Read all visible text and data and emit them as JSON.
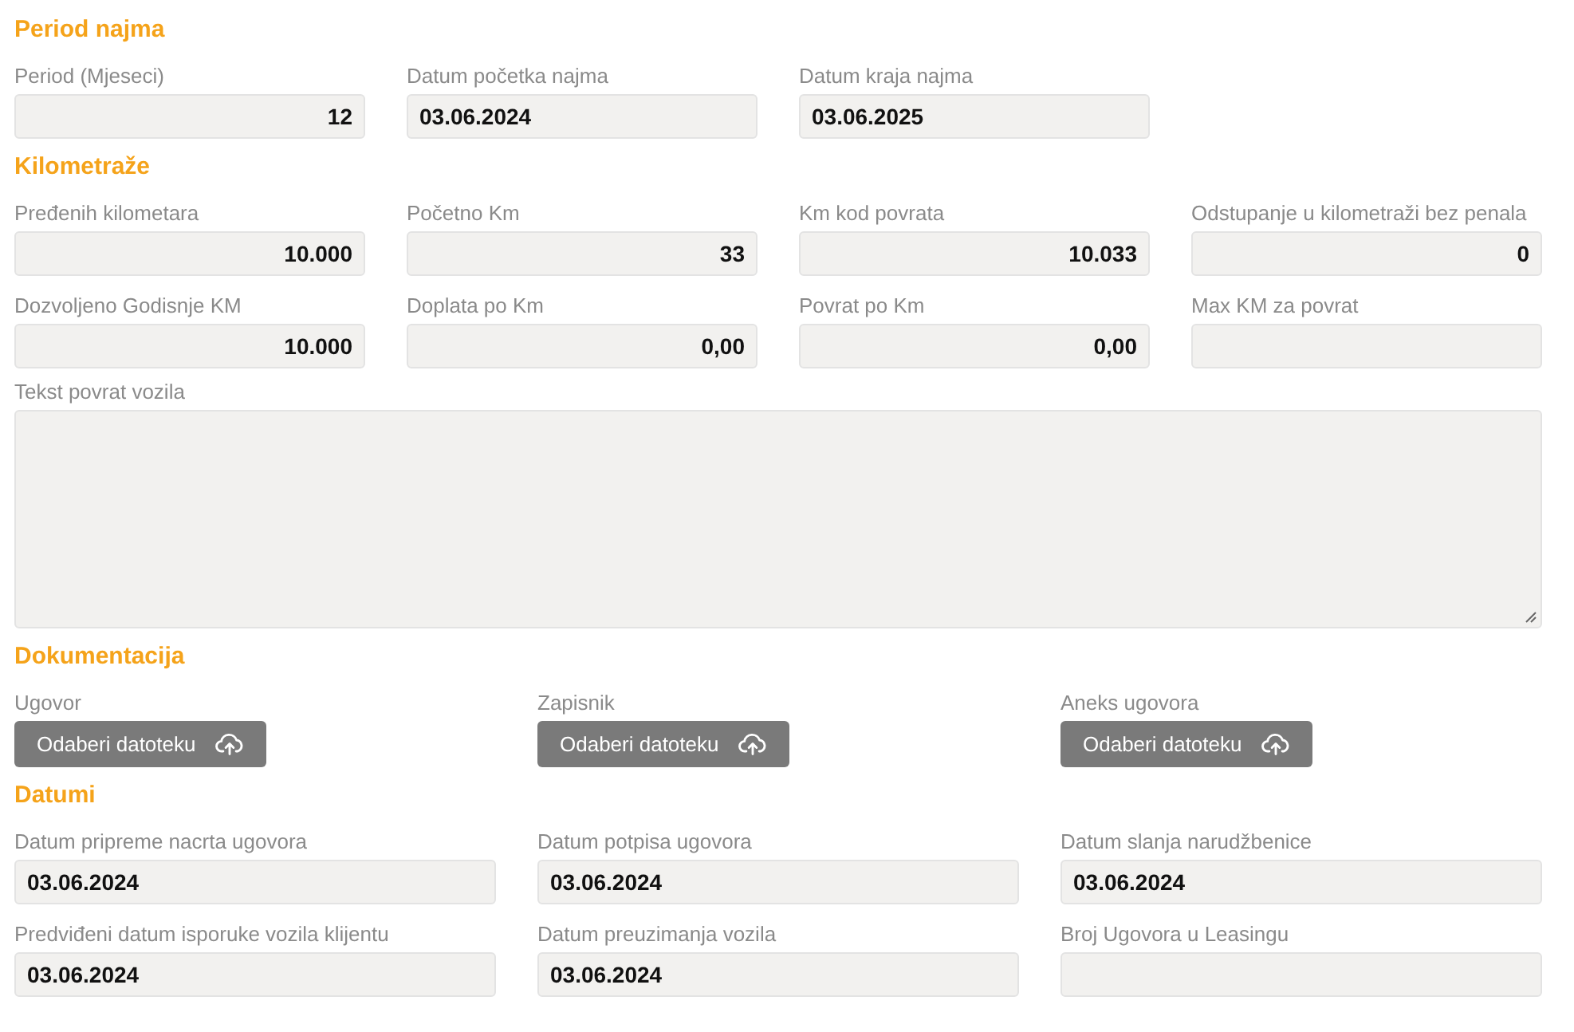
{
  "sections": [
    {
      "title": "Period najma",
      "kind": "quad",
      "fields": [
        {
          "kind": "number",
          "label": "Period (Mjeseci)",
          "value": "12"
        },
        {
          "kind": "text",
          "label": "Datum početka najma",
          "value": "03.06.2024"
        },
        {
          "kind": "text",
          "label": "Datum kraja najma",
          "value": "03.06.2025"
        }
      ]
    },
    {
      "title": "Kilometraže",
      "kind": "quad",
      "fields": [
        {
          "kind": "number",
          "label": "Pređenih kilometara",
          "value": "10.000"
        },
        {
          "kind": "number",
          "label": "Početno Km",
          "value": "33"
        },
        {
          "kind": "number",
          "label": "Km kod povrata",
          "value": "10.033"
        },
        {
          "kind": "number",
          "label": "Odstupanje u kilometraži bez penala",
          "value": "0"
        },
        {
          "kind": "number",
          "label": "Dozvoljeno Godisnje KM",
          "value": "10.000"
        },
        {
          "kind": "number",
          "label": "Doplata po Km",
          "value": "0,00"
        },
        {
          "kind": "number",
          "label": "Povrat po Km",
          "value": "0,00"
        },
        {
          "kind": "number",
          "label": "Max KM za povrat"
        },
        {
          "kind": "textarea",
          "label": "Tekst povrat vozila"
        }
      ]
    },
    {
      "title": "Dokumentacija",
      "kind": "triple",
      "fields": [
        {
          "kind": "file",
          "label": "Ugovor",
          "button": "Odaberi datoteku"
        },
        {
          "kind": "file",
          "label": "Zapisnik",
          "button": "Odaberi datoteku"
        },
        {
          "kind": "file",
          "label": "Aneks ugovora",
          "button": "Odaberi datoteku"
        }
      ]
    },
    {
      "title": "Datumi",
      "kind": "triple",
      "fields": [
        {
          "kind": "text",
          "label": "Datum pripreme nacrta ugovora",
          "value": "03.06.2024"
        },
        {
          "kind": "text",
          "label": "Datum potpisa ugovora",
          "value": "03.06.2024"
        },
        {
          "kind": "text",
          "label": "Datum slanja narudžbenice",
          "value": "03.06.2024"
        },
        {
          "kind": "text",
          "label": "Predviđeni datum isporuke vozila klijentu",
          "value": "03.06.2024"
        },
        {
          "kind": "text",
          "label": "Datum preuzimanja vozila",
          "value": "03.06.2024"
        },
        {
          "kind": "text",
          "label": "Broj Ugovora u Leasingu"
        }
      ]
    }
  ]
}
